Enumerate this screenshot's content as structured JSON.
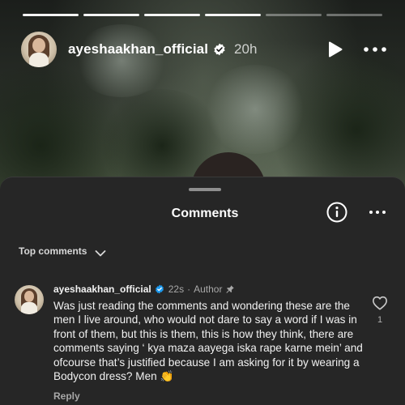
{
  "story": {
    "progress_total": 6,
    "progress_done": 4,
    "username": "ayeshaakhan_official",
    "time": "20h",
    "verified_icon": "verified-badge-icon",
    "play_icon": "play-icon",
    "more_icon": "more-horizontal-icon"
  },
  "comments_sheet": {
    "title": "Comments",
    "info_icon": "info-icon",
    "more_icon": "more-horizontal-icon",
    "sort_label": "Top comments",
    "sort_icon": "chevron-down-icon",
    "comments": [
      {
        "user": "ayeshaakhan_official",
        "time": "22s",
        "separator": "·",
        "author_label": "Author",
        "pinned_icon": "pin-icon",
        "text": "Was just reading the comments and wondering these are the men I live around, who would not dare to say a word if I was in front of them, but this is them, this is how they think, there are comments saying ‘ kya maza aayega iska rape karne mein’ and ofcourse that’s justified because I am asking for it by wearing a Bodycon dress? Men 👏",
        "reply_label": "Reply",
        "like_count": "1",
        "like_icon": "heart-icon"
      }
    ]
  },
  "colors": {
    "sheet_bg": "#262626",
    "verified_blue": "#1d9bf0",
    "muted_text": "#a8a8a8"
  }
}
